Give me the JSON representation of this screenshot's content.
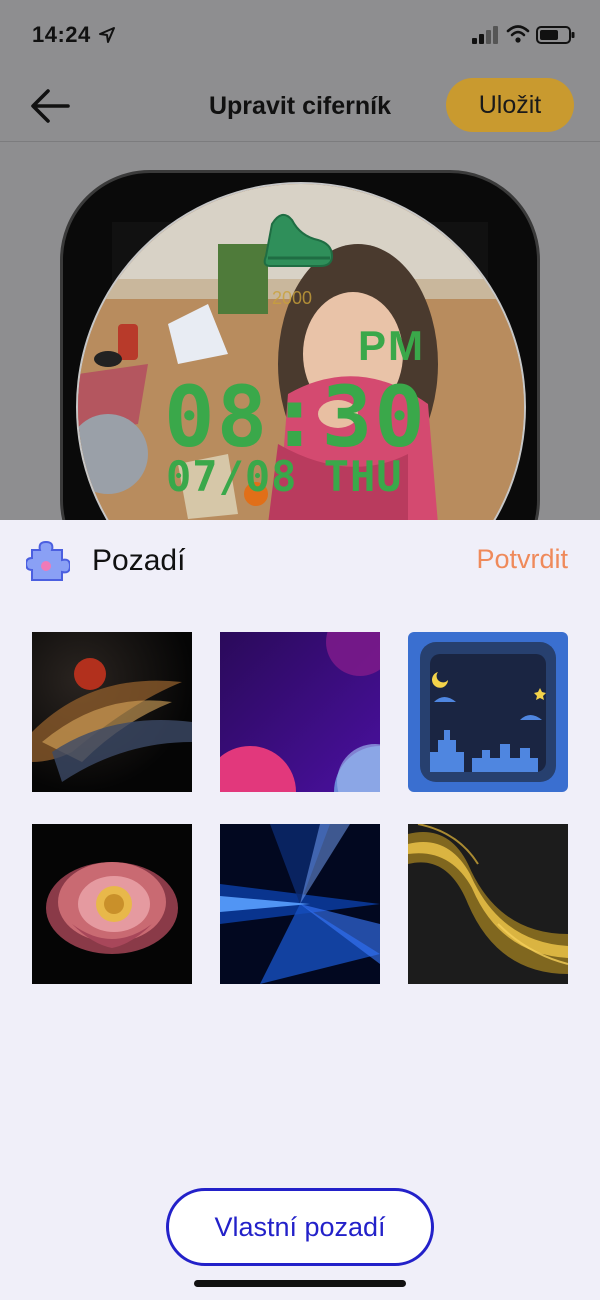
{
  "status_bar": {
    "time": "14:24",
    "icons": [
      "location-arrow-icon",
      "signal-icon",
      "wifi-icon",
      "battery-icon"
    ]
  },
  "nav": {
    "title": "Upravit ciferník",
    "save_label": "Uložit",
    "back_icon": "arrow-left-icon",
    "save_color": "#c99a2f"
  },
  "watch_face": {
    "steps": "2000",
    "ampm": "PM",
    "time": "08:30",
    "date": "07/08 THU",
    "accent_color": "#3aa84a"
  },
  "sheet": {
    "title": "Pozadí",
    "confirm_label": "Potvrdit",
    "confirm_color": "#ef8a5b",
    "custom_button_label": "Vlastní pozadí",
    "custom_button_color": "#2321c9"
  },
  "backgrounds": [
    {
      "name": "dark-swirl-moon"
    },
    {
      "name": "purple-planets"
    },
    {
      "name": "blue-night-city"
    },
    {
      "name": "peony-flower"
    },
    {
      "name": "blue-light-rays"
    },
    {
      "name": "gold-wave"
    }
  ]
}
